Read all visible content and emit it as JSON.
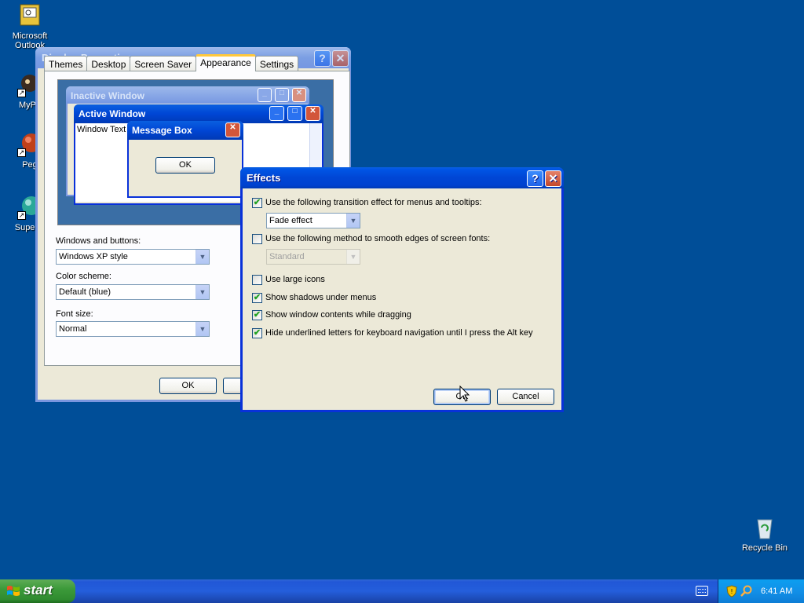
{
  "desktop": {
    "icons": [
      {
        "label": "Microsoft Outlook"
      },
      {
        "label": "MyPa"
      },
      {
        "label": "Peg"
      },
      {
        "label": "Superm"
      },
      {
        "label": "Recycle Bin"
      }
    ]
  },
  "display_properties": {
    "title": "Display Properties",
    "tabs": [
      "Themes",
      "Desktop",
      "Screen Saver",
      "Appearance",
      "Settings"
    ],
    "active_tab": "Appearance",
    "preview": {
      "inactive_title": "Inactive Window",
      "active_title": "Active Window",
      "window_text": "Window Text",
      "msgbox_title": "Message Box",
      "msgbox_ok": "OK"
    },
    "windows_buttons_label": "Windows and buttons:",
    "windows_buttons_value": "Windows XP style",
    "color_scheme_label": "Color scheme:",
    "color_scheme_value": "Default (blue)",
    "font_size_label": "Font size:",
    "font_size_value": "Normal",
    "ok_label": "OK"
  },
  "effects": {
    "title": "Effects",
    "options": [
      {
        "label": "Use the following transition effect for menus and tooltips:",
        "checked": true
      },
      {
        "label": "Use the following method to smooth edges of screen fonts:",
        "checked": false
      },
      {
        "label": "Use large icons",
        "checked": false
      },
      {
        "label": "Show shadows under menus",
        "checked": true
      },
      {
        "label": "Show window contents while dragging",
        "checked": true
      },
      {
        "label": "Hide underlined letters for keyboard navigation until I press the Alt key",
        "checked": true
      }
    ],
    "transition_value": "Fade effect",
    "smoothing_value": "Standard",
    "ok_label": "OK",
    "cancel_label": "Cancel"
  },
  "taskbar": {
    "start_label": "start",
    "clock": "6:41 AM"
  }
}
